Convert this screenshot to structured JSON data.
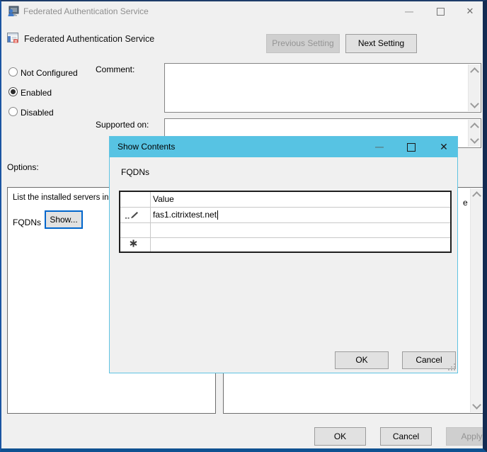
{
  "window": {
    "title": "Federated Authentication Service",
    "minimize_glyph": "—",
    "close_glyph": "✕"
  },
  "header": {
    "setting_name": "Federated Authentication Service",
    "previous_button": "Previous Setting",
    "next_button": "Next Setting"
  },
  "radios": {
    "items": [
      {
        "label": "Not Configured",
        "selected": false
      },
      {
        "label": "Enabled",
        "selected": true
      },
      {
        "label": "Disabled",
        "selected": false
      }
    ]
  },
  "comment": {
    "label": "Comment:",
    "value": ""
  },
  "supported": {
    "label": "Supported on:",
    "value": ""
  },
  "options_panel": {
    "label": "Options:",
    "description": "List the installed servers in y",
    "fqdns_label": "FQDNs",
    "show_button": "Show..."
  },
  "help_panel": {
    "visible_text": "e"
  },
  "dialog": {
    "title": "Show Contents",
    "minimize_glyph": "—",
    "close_glyph": "✕",
    "fqdns_label": "FQDNs",
    "grid": {
      "columns": [
        "",
        "Value"
      ],
      "rows": [
        {
          "indicator": "pencil",
          "value": "fas1.citrixtest.net",
          "editing": true
        },
        {
          "indicator": "",
          "value": ""
        },
        {
          "indicator": "asterisk",
          "value": ""
        }
      ]
    },
    "ok_button": "OK",
    "cancel_button": "Cancel"
  },
  "footer": {
    "ok_button": "OK",
    "cancel_button": "Cancel",
    "apply_button": "Apply"
  },
  "colors": {
    "dialog_titlebar": "#57c3e3",
    "focus_border": "#0066cc",
    "window_border_bottom": "#0f5191",
    "titlebar_text": "#8f8f8f"
  }
}
